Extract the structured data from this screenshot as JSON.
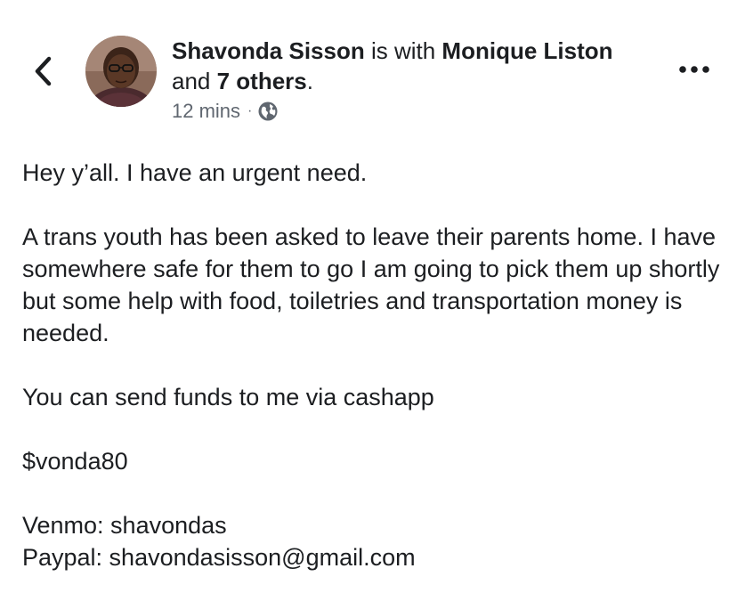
{
  "header": {
    "author": "Shavonda Sisson",
    "is_with_text": " is with ",
    "tagged_person": "Monique Liston",
    "and_text": "and ",
    "others_link": "7 others",
    "period": ".",
    "timestamp": "12 mins",
    "separator": "·",
    "privacy_icon": "globe-icon",
    "back_icon": "chevron-left-icon",
    "more_icon": "more-dots-icon"
  },
  "post": {
    "paragraph_1": "Hey y’all. I have an urgent need.",
    "paragraph_2": "A trans youth has been asked to leave their parents home. I have somewhere safe for them to go I am going to pick them up shortly but some help with food, toiletries and transportation money is needed.",
    "paragraph_3": "You can send funds to me via cashapp",
    "paragraph_4": "$vonda80",
    "venmo_line": "Venmo: shavondas",
    "paypal_line": "Paypal: shavondasisson@gmail.com"
  },
  "colors": {
    "text": "#1c1e21",
    "meta": "#606770"
  }
}
